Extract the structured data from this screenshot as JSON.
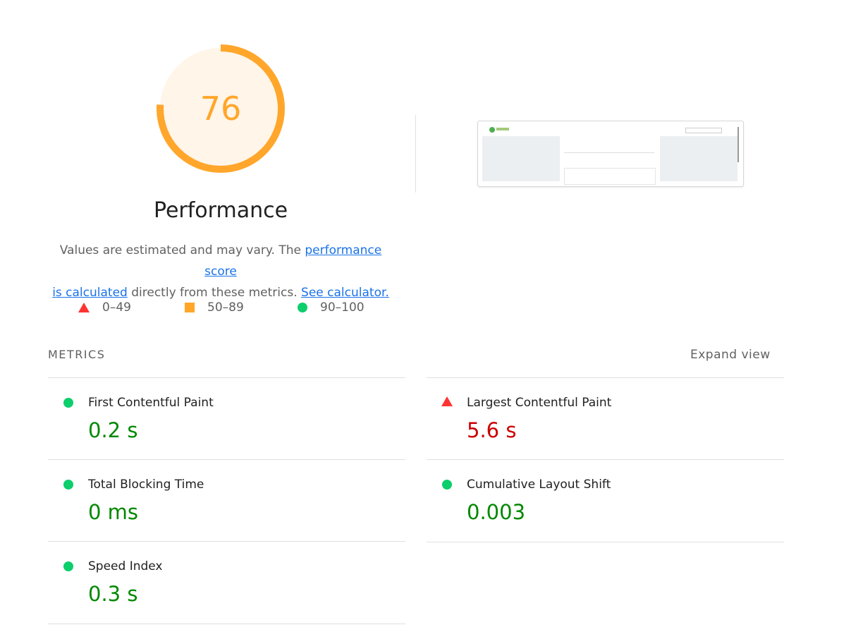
{
  "score": {
    "value": "76",
    "fraction": 0.76,
    "title": "Performance",
    "color": "#ffa62b",
    "background": "#fff5e8"
  },
  "description": {
    "prefix": "Values are estimated and may vary. The",
    "link1_line1": "performance score",
    "link1_line2": "is calculated",
    "middle": "directly from these metrics.",
    "link2": "See calculator."
  },
  "legend": [
    {
      "icon": "triangle-icon",
      "label": "0–49",
      "color": "#ff3333"
    },
    {
      "icon": "square-icon",
      "label": "50–89",
      "color": "#ffa62b"
    },
    {
      "icon": "circle-icon",
      "label": "90–100",
      "color": "#0cce6b"
    }
  ],
  "metrics_section": {
    "heading": "METRICS",
    "expand_label": "Expand view"
  },
  "metrics": [
    {
      "label": "First Contentful Paint",
      "value": "0.2 s",
      "rating": "pass",
      "icon": "circle-icon"
    },
    {
      "label": "Largest Contentful Paint",
      "value": "5.6 s",
      "rating": "fail",
      "icon": "triangle-icon"
    },
    {
      "label": "Total Blocking Time",
      "value": "0 ms",
      "rating": "pass",
      "icon": "circle-icon"
    },
    {
      "label": "Cumulative Layout Shift",
      "value": "0.003",
      "rating": "pass",
      "icon": "circle-icon"
    },
    {
      "label": "Speed Index",
      "value": "0.3 s",
      "rating": "pass",
      "icon": "circle-icon"
    }
  ],
  "colors": {
    "pass": "#008800",
    "fail": "#cc0000",
    "link": "#1a73e8"
  }
}
